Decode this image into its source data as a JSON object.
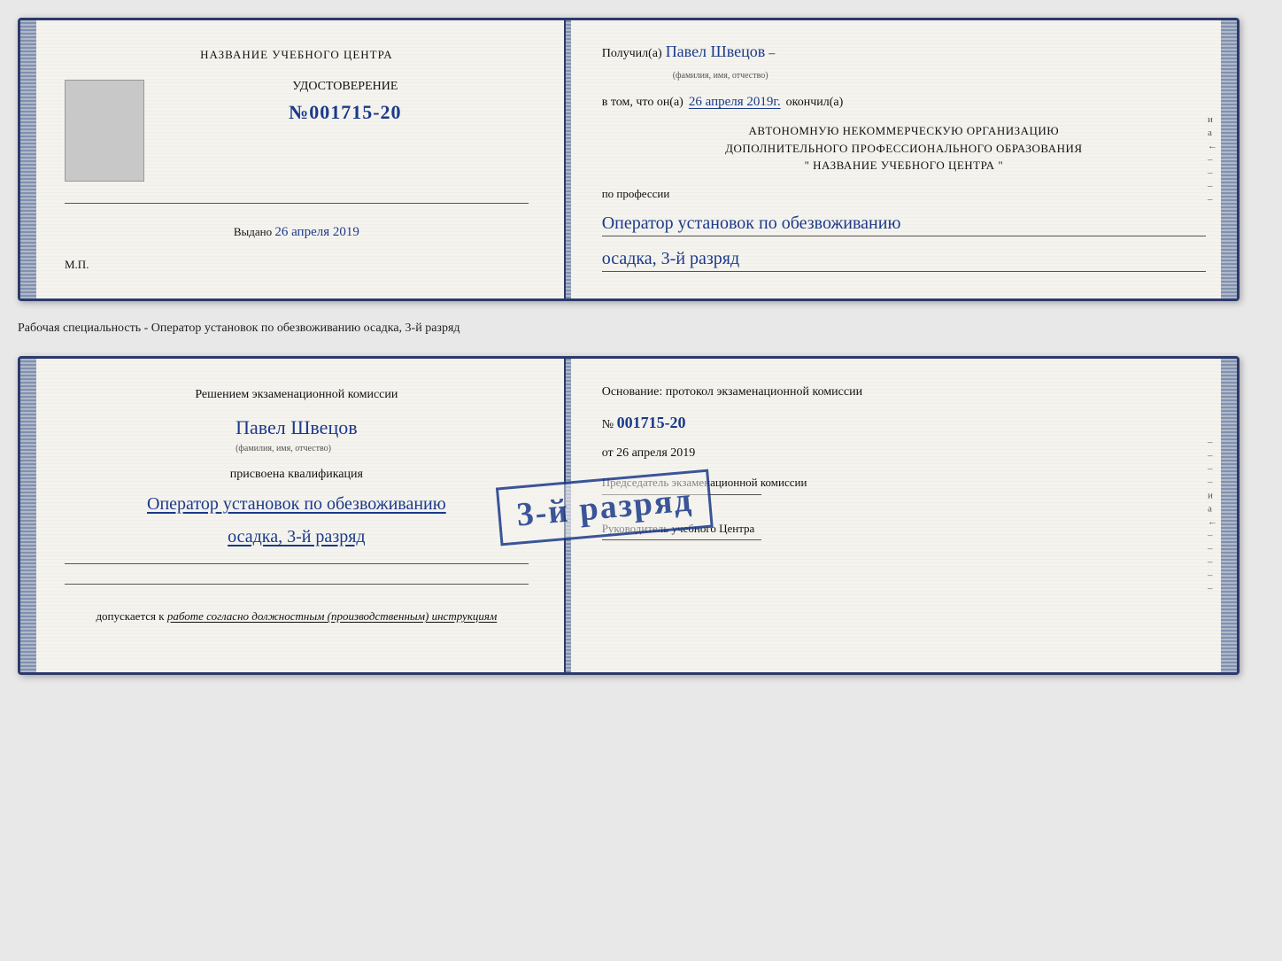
{
  "page": {
    "background": "#e8e8e8"
  },
  "separator_text": "Рабочая специальность - Оператор установок по обезвоживанию осадка, 3-й разряд",
  "doc1": {
    "left": {
      "title": "НАЗВАНИЕ УЧЕБНОГО ЦЕНТРА",
      "cert_label": "УДОСТОВЕРЕНИЕ",
      "cert_number_prefix": "№",
      "cert_number": "001715-20",
      "issued_prefix": "Выдано",
      "issued_date": "26 апреля 2019",
      "mp_label": "М.П."
    },
    "right": {
      "received_prefix": "Получил(а)",
      "person_name": "Павел Швецов",
      "name_label": "(фамилия, имя, отчество)",
      "dash": "–",
      "in_that_prefix": "в том, что он(а)",
      "date_handwritten": "26 апреля 2019г.",
      "finished": "окончил(а)",
      "org_line1": "АВТОНОМНУЮ НЕКОММЕРЧЕСКУЮ ОРГАНИЗАЦИЮ",
      "org_line2": "ДОПОЛНИТЕЛЬНОГО ПРОФЕССИОНАЛЬНОГО ОБРАЗОВАНИЯ",
      "org_line3": "\"   НАЗВАНИЕ УЧЕБНОГО ЦЕНТРА   \"",
      "profession_label": "по профессии",
      "profession_value": "Оператор установок по обезвоживанию",
      "profession_value2": "осадка, 3-й разряд",
      "side_letters": [
        "и",
        "а",
        "←",
        "–",
        "–",
        "–",
        "–"
      ]
    }
  },
  "doc2": {
    "left": {
      "decision_text": "Решением экзаменационной комиссии",
      "person_name": "Павел Швецов",
      "name_label": "(фамилия, имя, отчество)",
      "assigned_label": "присвоена квалификация",
      "qualification_value": "Оператор установок по обезвоживанию",
      "qualification_value2": "осадка, 3-й разряд",
      "allowed_prefix": "допускается к",
      "allowed_italic": "работе согласно должностным (производственным) инструкциям"
    },
    "right": {
      "basis_label": "Основание: протокол экзаменационной комиссии",
      "protocol_prefix": "№",
      "protocol_number": "001715-20",
      "date_prefix": "от",
      "date_value": "26 апреля 2019",
      "chairman_label": "Председатель экзаменационной комиссии",
      "director_label": "Руководитель учебного Центра",
      "side_letters": [
        "–",
        "–",
        "–",
        "–",
        "и",
        "а",
        "←",
        "–",
        "–",
        "–",
        "–",
        "–"
      ]
    },
    "stamp": {
      "text": "3-й разряд"
    }
  }
}
